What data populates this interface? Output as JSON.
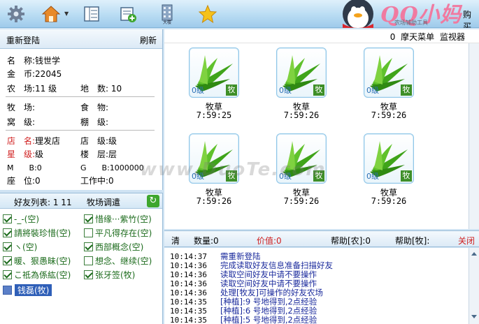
{
  "toolbar": {
    "buttons": [
      "settings-icon",
      "home-icon",
      "list-icon",
      "add-card-icon",
      "building-icon",
      "star-icon"
    ],
    "logo_title": "QQ小妈",
    "logo_sub": "农场辅助工具",
    "logo_right": "购买"
  },
  "info": {
    "header_left": "重新登陆",
    "header_right": "刷新",
    "name_label": "名　称:",
    "name_value": "钱世学",
    "coin_label": "金　币:",
    "coin_value": "22045",
    "farm_label": "农　场:",
    "farm_value": "11 级",
    "land_label": "地　数:",
    "land_value": "10",
    "ranch_label": "牧　场:",
    "ranch_value": "",
    "food_label": "食　物:",
    "food_value": "",
    "nest_label": "窝　级:",
    "nest_value": "",
    "shed_label": "棚　级:",
    "shed_value": "",
    "shop_name_label": "店　名:",
    "shop_name_value": "理发店",
    "shop_level_label": "店　级:",
    "shop_level_value": "级",
    "star_label": "星　级:",
    "star_value": "级",
    "floor_label": "楼　层:",
    "floor_value": "层",
    "m_label": "M　　B:",
    "m_value": "0",
    "g_label": "G　　B:",
    "g_value": "1000000",
    "seat_label": "座　位:",
    "seat_value": "0",
    "work_label": "工作中:",
    "work_value": "0"
  },
  "friends": {
    "header_left": "好友列表: 1  11",
    "header_right": "牧场调遣",
    "items": [
      {
        "label": "-_-(空)"
      },
      {
        "label": "惜缘···紫竹(空)"
      },
      {
        "label": "請將裝珍惜(空)"
      },
      {
        "label": "平凡得存在(空)"
      },
      {
        "label": "ヽ(空)"
      },
      {
        "label": "西部概念(空)"
      },
      {
        "label": "暖、狠愚昧(空)"
      },
      {
        "label": "想念、继续(空)"
      },
      {
        "label": "こ祗為係紘(空)"
      },
      {
        "label": "张牙签(牧)"
      }
    ],
    "selected": "钱磊(牧)"
  },
  "main": {
    "header": "0  摩天菜单 监视器",
    "tiles": [
      {
        "level": "0级",
        "tag": "牧",
        "name": "牧草",
        "time": "7:59:25"
      },
      {
        "level": "0级",
        "tag": "牧",
        "name": "牧草",
        "time": "7:59:26"
      },
      {
        "level": "0级",
        "tag": "牧",
        "name": "牧草",
        "time": "7:59:26"
      },
      {
        "level": "0级",
        "tag": "牧",
        "name": "牧草",
        "time": "7:59:26"
      },
      {
        "level": "0级",
        "tag": "牧",
        "name": "牧草",
        "time": "7:59:26"
      },
      {
        "level": "0级",
        "tag": "牧",
        "name": "牧草",
        "time": "7:59:26"
      }
    ]
  },
  "status": {
    "clear": "清",
    "quantity": "数量:0",
    "price": "价值:0",
    "help_farm": "帮助[农]:0",
    "help_ranch": "帮助[牧]:",
    "close": "关闭"
  },
  "log": [
    {
      "time": "10:14:37",
      "msg": "需重新登陆"
    },
    {
      "time": "10:14:36",
      "msg": "完成读取好友信息准备扫描好友"
    },
    {
      "time": "10:14:36",
      "msg": "读取空间好友中请不要操作"
    },
    {
      "time": "10:14:36",
      "msg": "读取空间好友中请不要操作"
    },
    {
      "time": "10:14:36",
      "msg": "处理[牧友]可操作的好友农场"
    },
    {
      "time": "10:14:35",
      "msg": "[种植]:9 号地得到,2点经验"
    },
    {
      "time": "10:14:35",
      "msg": "[种植]:6 号地得到,2点经验"
    },
    {
      "time": "10:14:35",
      "msg": "[种植]:5 号地得到,2点经验"
    }
  ],
  "watermark": "www.DuoTe.com"
}
